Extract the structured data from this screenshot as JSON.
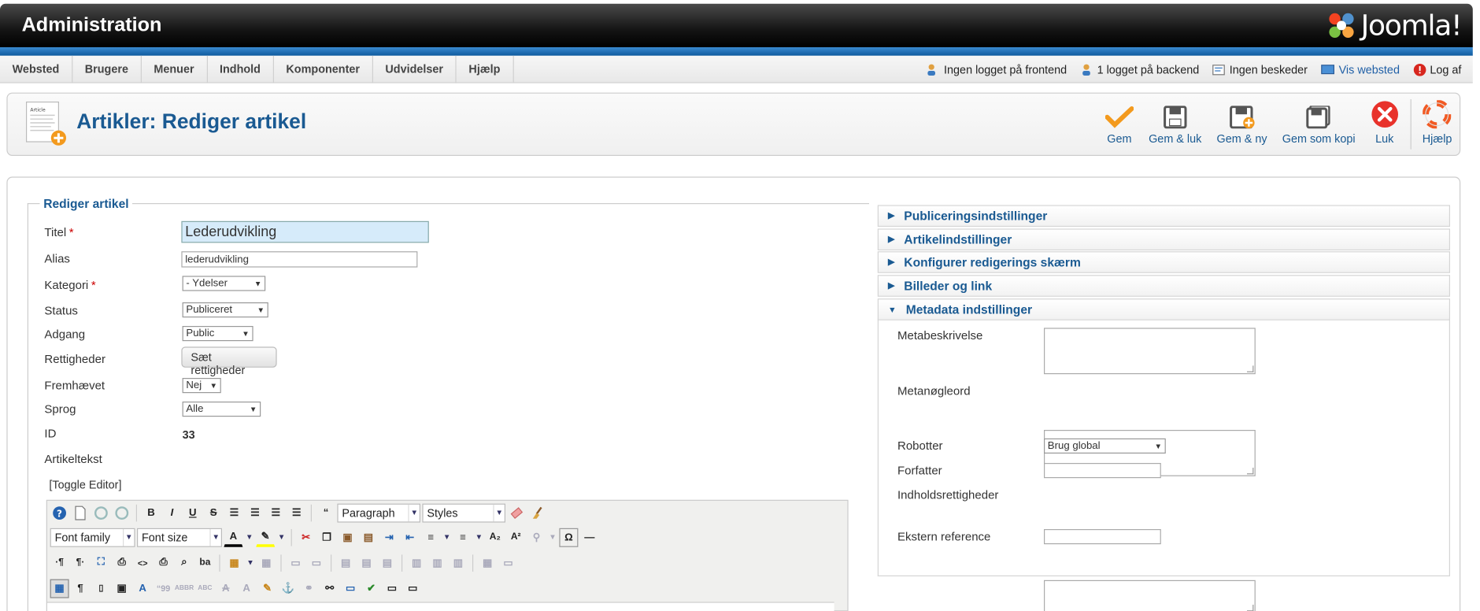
{
  "header": {
    "title": "Administration",
    "logo_text": "Joomla!"
  },
  "menu": {
    "items": [
      "Websted",
      "Brugere",
      "Menuer",
      "Indhold",
      "Komponenter",
      "Udvidelser",
      "Hjælp"
    ]
  },
  "status": {
    "frontend": "Ingen logget på frontend",
    "backend": "1 logget på backend",
    "messages": "Ingen beskeder",
    "view_site": "Vis websted",
    "logout": "Log af"
  },
  "toolbar": {
    "page_title": "Artikler: Rediger artikel",
    "icon_text": "Article",
    "save": "Gem",
    "save_close": "Gem & luk",
    "save_new": "Gem & ny",
    "save_copy": "Gem som kopi",
    "close": "Luk",
    "help": "Hjælp"
  },
  "form": {
    "legend": "Rediger artikel",
    "title_label": "Titel",
    "title_value": "Lederudvikling",
    "alias_label": "Alias",
    "alias_value": "lederudvikling",
    "category_label": "Kategori",
    "category_value": "- Ydelser",
    "status_label": "Status",
    "status_value": "Publiceret",
    "access_label": "Adgang",
    "access_value": "Public",
    "permissions_label": "Rettigheder",
    "permissions_button": "Sæt rettigheder",
    "featured_label": "Fremhævet",
    "featured_value": "Nej",
    "language_label": "Sprog",
    "language_value": "Alle",
    "id_label": "ID",
    "id_value": "33",
    "article_text_label": "Artikeltekst",
    "toggle_editor": "[Toggle Editor]",
    "required_mark": "*"
  },
  "editor": {
    "paragraph": "Paragraph",
    "styles": "Styles",
    "font_family": "Font family",
    "font_size": "Font size"
  },
  "panels": {
    "publishing": "Publiceringsindstillinger",
    "article_options": "Artikelindstillinger",
    "configure_edit": "Konfigurer redigerings skærm",
    "images_links": "Billeder og link",
    "metadata": "Metadata indstillinger"
  },
  "metadata": {
    "description_label": "Metabeskrivelse",
    "keywords_label": "Metanøgleord",
    "robots_label": "Robotter",
    "robots_value": "Brug global",
    "author_label": "Forfatter",
    "rights_label": "Indholdsrettigheder",
    "xref_label": "Ekstern reference"
  },
  "colors": {
    "accent": "#1a5a92",
    "header": "#111111",
    "strip": "#1f6fb8",
    "close": "#e8322b",
    "check": "#f39a1e"
  }
}
